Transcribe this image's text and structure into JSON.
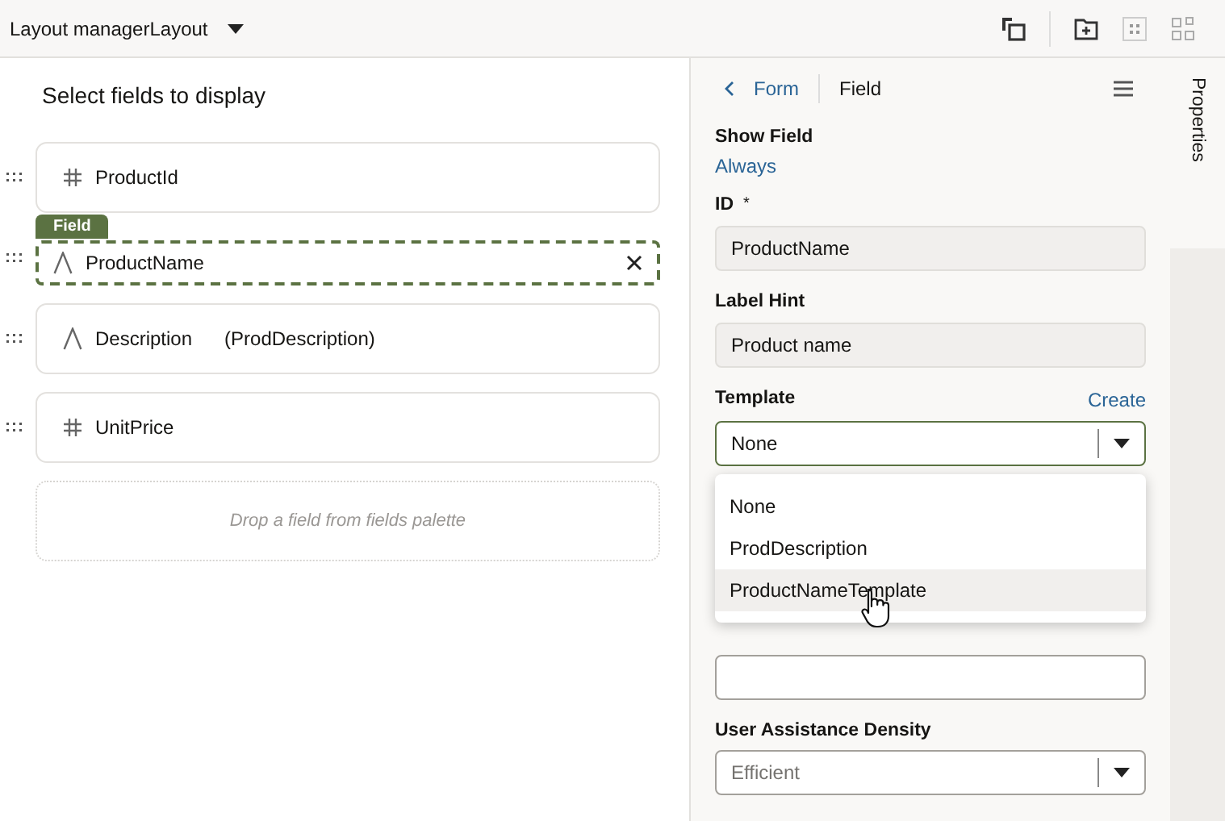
{
  "header": {
    "title": "Layout managerLayout"
  },
  "canvas": {
    "heading": "Select fields to display",
    "fields": [
      {
        "kind": "number",
        "name": "ProductId",
        "selected": false
      },
      {
        "kind": "text",
        "name": "ProductName",
        "selected": true,
        "badge": "Field"
      },
      {
        "kind": "text",
        "name": "Description",
        "template": "(ProdDescription)",
        "selected": false
      },
      {
        "kind": "number",
        "name": "UnitPrice",
        "selected": false
      }
    ],
    "drop_zone": "Drop a field from fields palette"
  },
  "properties": {
    "back": "Form",
    "title": "Field",
    "show_field": {
      "label": "Show Field",
      "value": "Always"
    },
    "id": {
      "label": "ID",
      "required": "*",
      "value": "ProductName"
    },
    "label_hint": {
      "label": "Label Hint",
      "value": "Product name"
    },
    "template": {
      "label": "Template",
      "link": "Create",
      "value": "None",
      "options": [
        {
          "label": "None",
          "hovered": false
        },
        {
          "label": "ProdDescription",
          "hovered": false
        },
        {
          "label": "ProductNameTemplate",
          "hovered": true
        }
      ]
    },
    "density": {
      "label": "User Assistance Density",
      "placeholder": "Efficient"
    }
  },
  "side_tabs": [
    {
      "label": "Properties",
      "selected": true
    }
  ]
}
